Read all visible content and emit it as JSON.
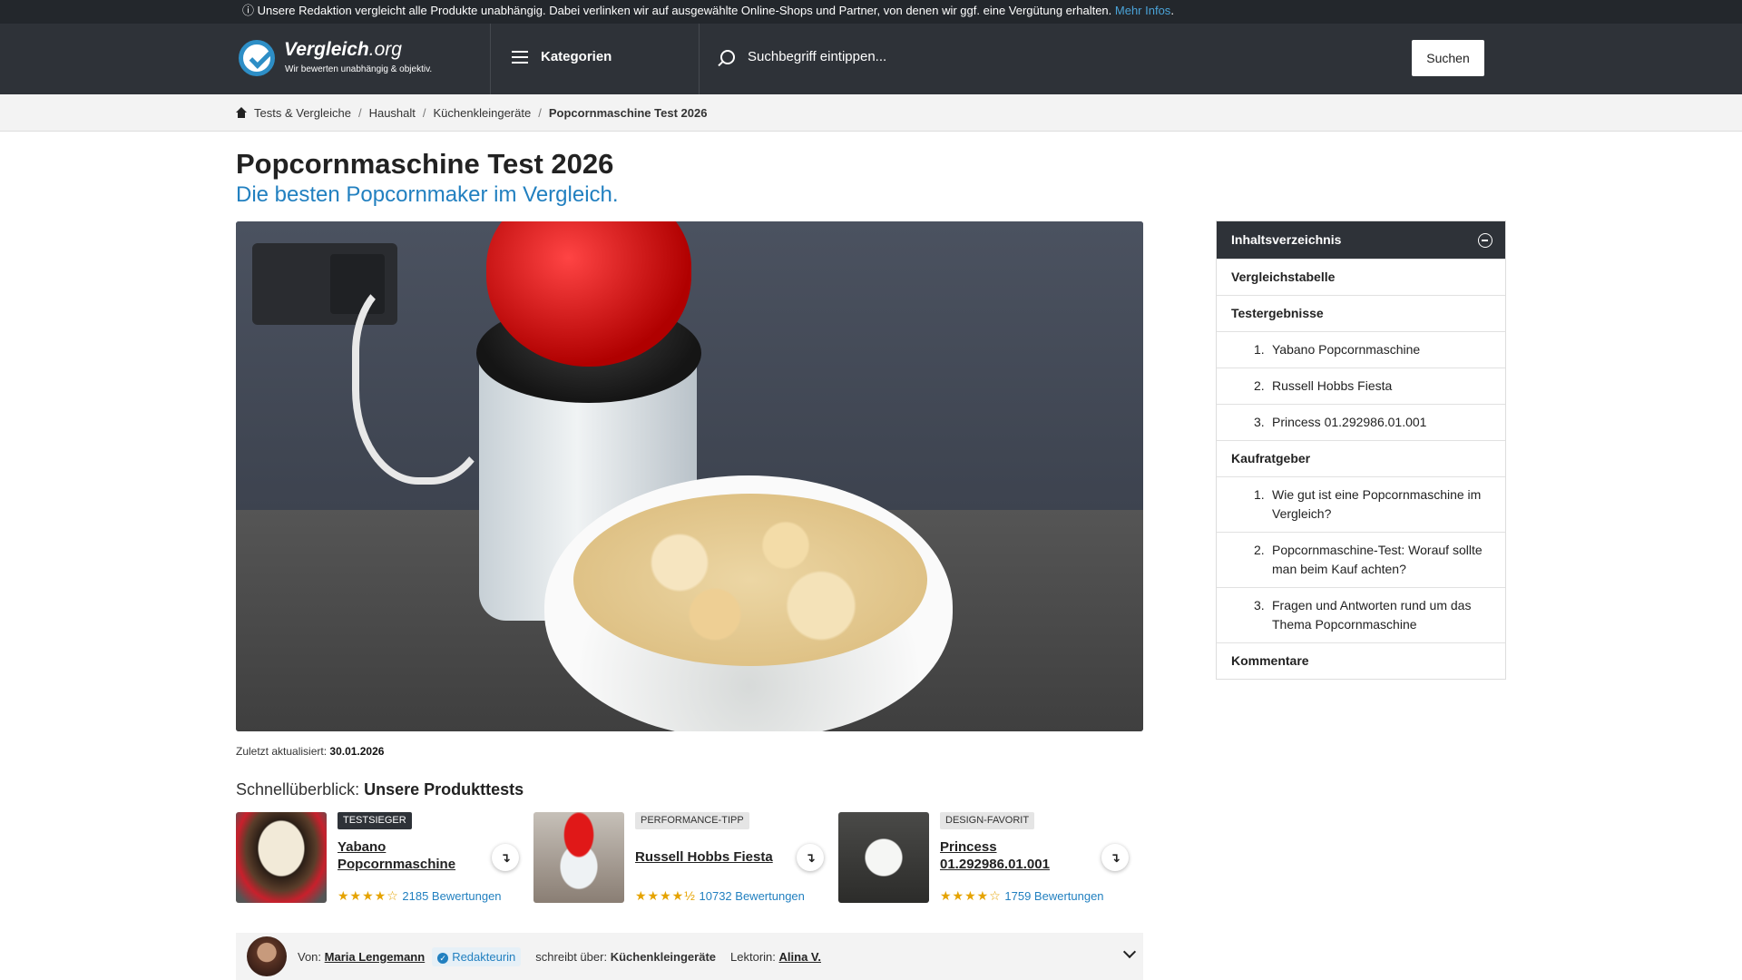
{
  "notice": {
    "text": "ⓘ Unsere Redaktion vergleicht alle Produkte unabhängig. Dabei verlinken wir auf ausgewählte Online-Shops und Partner, von denen wir ggf. eine Vergütung erhalten.",
    "link": "Mehr Infos",
    "end": "."
  },
  "header": {
    "logo_name": "Vergleich",
    "logo_tld": ".org",
    "logo_slogan": "Wir bewerten unabhängig & objektiv.",
    "menu_label": "Kategorien",
    "search_placeholder": "Suchbegriff eintippen...",
    "search_button": "Suchen"
  },
  "breadcrumb": {
    "items": [
      "Tests & Vergleiche",
      "Haushalt",
      "Küchenkleingeräte"
    ],
    "current": "Popcornmaschine Test 2026",
    "sep": "/"
  },
  "page": {
    "title": "Popcornmaschine Test 2026",
    "subtitle": "Die besten Popcornmaker im Vergleich.",
    "updated_label": "Zuletzt aktualisiert:",
    "updated_date": "30.01.2026",
    "quick_prefix": "Schnellüberblick:",
    "quick_title": "Unsere Produkttests"
  },
  "products": [
    {
      "badge": "TESTSIEGER",
      "name_line1": "Yabano",
      "name_line2": "Popcornmaschine",
      "stars": "★★★★☆",
      "rating_count": "2185 Bewertungen"
    },
    {
      "badge": "PERFORMANCE-TIPP",
      "name_line1": "Russell Hobbs Fiesta",
      "name_line2": "",
      "stars": "★★★★½",
      "rating_count": "10732 Bewertungen"
    },
    {
      "badge": "DESIGN-FAVORIT",
      "name_line1": "Princess",
      "name_line2": "01.292986.01.001",
      "stars": "★★★★☆",
      "rating_count": "1759 Bewertungen"
    }
  ],
  "author": {
    "by_label": "Von:",
    "name": "Maria Lengemann",
    "role": "Redakteurin",
    "writes_label": "schreibt über:",
    "topic": "Küchenkleingeräte",
    "editor_label": "Lektorin:",
    "editor": "Alina V."
  },
  "toc": {
    "title": "Inhaltsverzeichnis",
    "items": [
      {
        "label": "Vergleichstabelle"
      },
      {
        "label": "Testergebnisse"
      },
      {
        "num": "1.",
        "label": "Yabano Popcornmaschine"
      },
      {
        "num": "2.",
        "label": "Russell Hobbs Fiesta"
      },
      {
        "num": "3.",
        "label": "Princess 01.292986.01.001"
      },
      {
        "label": "Kaufratgeber"
      },
      {
        "num": "1.",
        "label": "Wie gut ist eine Popcornmaschine im Vergleich?"
      },
      {
        "num": "2.",
        "label": "Popcornmaschine-Test: Worauf sollte man beim Kauf achten?"
      },
      {
        "num": "3.",
        "label": "Fragen und Antworten rund um das Thema Popcornmaschine"
      },
      {
        "label": "Kommentare"
      }
    ]
  },
  "colors": {
    "header_bg": "#2e3238",
    "accent_blue": "#2280c0",
    "star": "#e5a300"
  },
  "icons": [
    "info-icon",
    "logo-check-icon",
    "hamburger-icon",
    "search-icon",
    "home-icon",
    "arrow-link-icon",
    "verified-icon",
    "chevron-down-icon",
    "collapse-icon"
  ]
}
